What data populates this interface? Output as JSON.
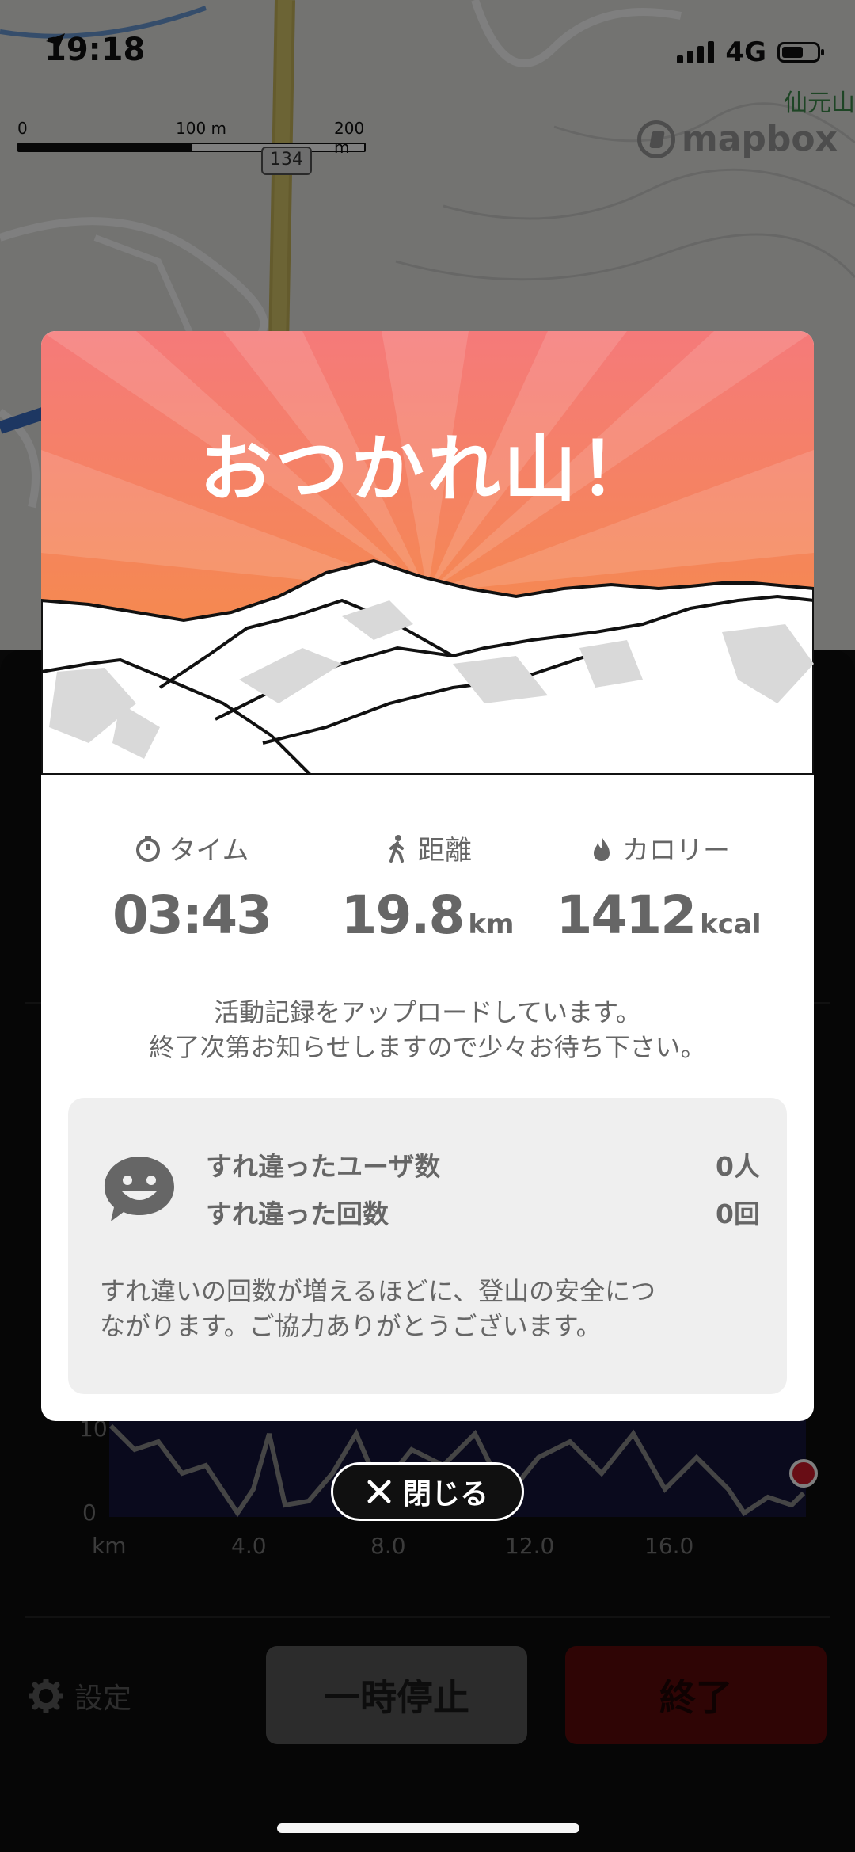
{
  "status_bar": {
    "time": "19:18",
    "network": "4G"
  },
  "map": {
    "scale_labels": [
      "0",
      "100 m",
      "200 m"
    ],
    "road_number": "134",
    "attribution": "mapbox",
    "place_name": "仙元山"
  },
  "modal": {
    "title": "おつかれ山！",
    "stats": [
      {
        "label": "タイム",
        "icon": "stopwatch-icon",
        "value": "03:43",
        "unit": ""
      },
      {
        "label": "距離",
        "icon": "hiker-icon",
        "value": "19.8",
        "unit": "km"
      },
      {
        "label": "カロリー",
        "icon": "flame-icon",
        "value": "1412",
        "unit": "kcal"
      }
    ],
    "upload_message_line1": "活動記録をアップロードしています。",
    "upload_message_line2": "終了次第お知らせしますので少々お待ち下さい。",
    "encounter": {
      "users_label": "すれ違ったユーザ数",
      "users_value": "0人",
      "count_label": "すれ違った回数",
      "count_value": "0回",
      "note_line1": "すれ違いの回数が増えるほどに、登山の安全につ",
      "note_line2": "ながります。ご協力ありがとうございます。"
    },
    "close_label": "閉じる"
  },
  "chart": {
    "y_ticks": [
      "10",
      "0"
    ],
    "x_unit": "km",
    "x_ticks": [
      "4.0",
      "8.0",
      "12.0",
      "16.0"
    ]
  },
  "controls": {
    "settings_label": "設定",
    "pause_label": "一時停止",
    "end_label": "終了"
  },
  "colors": {
    "hero_top": "#f6837a",
    "hero_bottom": "#f5913a",
    "end_button": "#5f0a0a"
  }
}
